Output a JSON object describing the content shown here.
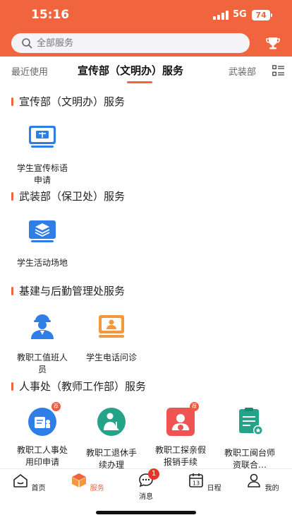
{
  "status_bar": {
    "time": "15:16",
    "network": "5G",
    "battery": "74"
  },
  "search": {
    "placeholder": "全部服务"
  },
  "tabs": {
    "recent": "最近使用",
    "active": "宣传部（文明办）服务",
    "next": "武装部"
  },
  "colors": {
    "accent": "#f0653d",
    "blue": "#2f7ee8",
    "orange": "#f29a3b",
    "teal": "#25a389",
    "red": "#ef5452"
  },
  "sections": [
    {
      "title": "宣传部（文明办）服务",
      "items": [
        {
          "label": "学生宣传标语申请",
          "icon": "banner-icon"
        }
      ]
    },
    {
      "title": "武装部（保卫处）服务",
      "items": [
        {
          "label": "学生活动场地",
          "icon": "layers-icon"
        }
      ]
    },
    {
      "title": "基建与后勤管理处服务",
      "items": [
        {
          "label": "教职工值班人员",
          "icon": "staff-icon"
        },
        {
          "label": "学生电话问诊",
          "icon": "phone-consult-icon"
        }
      ]
    },
    {
      "title": "人事处（教师工作部）服务",
      "items": [
        {
          "label": "教职工人事处用印申请",
          "icon": "seal-icon",
          "badge": "荐"
        },
        {
          "label": "教职工退休手续办理",
          "icon": "retire-icon"
        },
        {
          "label": "教职工探亲假报销手续",
          "icon": "reimburse-icon",
          "badge": "荐"
        },
        {
          "label": "教职工闽台师资联合…",
          "icon": "checklist-icon"
        }
      ]
    }
  ],
  "bottom_nav": [
    {
      "label": "首页",
      "icon": "home-icon"
    },
    {
      "label": "服务",
      "icon": "service-box-icon",
      "active": true
    },
    {
      "label": "消息",
      "icon": "chat-icon",
      "badge": "1"
    },
    {
      "label": "日程",
      "icon": "calendar-icon",
      "day": "13"
    },
    {
      "label": "我的",
      "icon": "user-icon"
    }
  ]
}
